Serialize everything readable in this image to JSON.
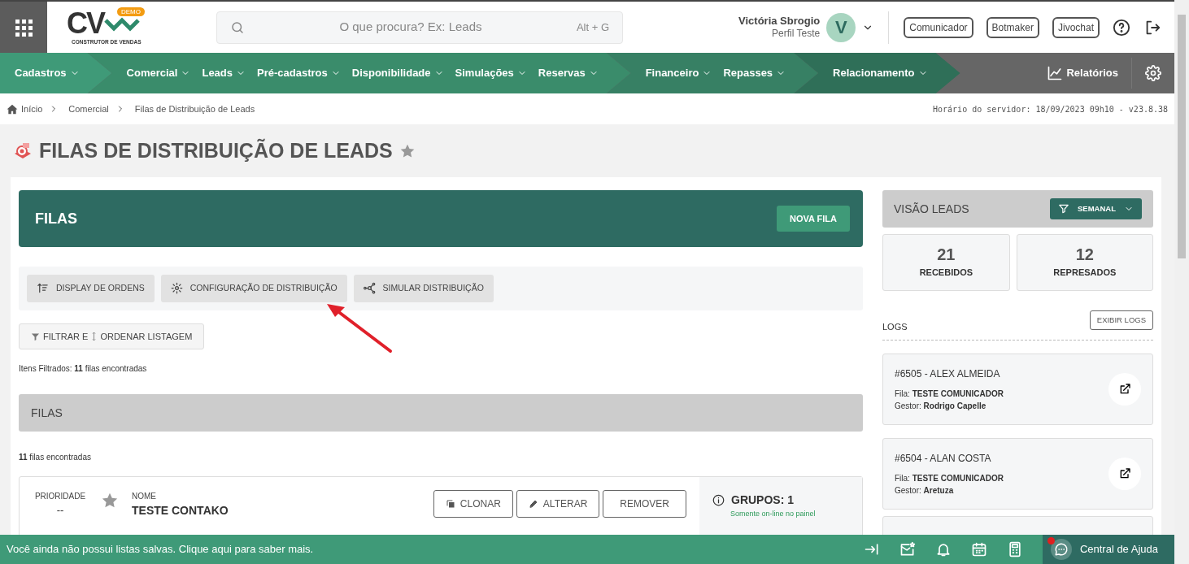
{
  "header": {
    "logo": {
      "mark": "CV",
      "badge": "DEMO",
      "tagline": "CONSTRUTOR DE VENDAS"
    },
    "search": {
      "placeholder": "O que procura? Ex: Leads",
      "shortcut": "Alt + G"
    },
    "user": {
      "name": "Victória Sbrogio",
      "profile": "Perfil Teste",
      "initial": "V"
    },
    "buttons": [
      "Comunicador",
      "Botmaker",
      "Jivochat"
    ]
  },
  "nav": {
    "groups": [
      {
        "color": "#3f9a78",
        "items": [
          "Cadastros"
        ]
      },
      {
        "color": "#3a8c6b",
        "items": [
          "Comercial",
          "Leads",
          "Pré-cadastros",
          "Disponibilidade",
          "Simulações",
          "Reservas"
        ]
      },
      {
        "color": "#378064",
        "items": [
          "Financeiro",
          "Repasses"
        ]
      },
      {
        "color": "#2f6f58",
        "items": [
          "Relacionamento"
        ]
      }
    ],
    "reports": "Relatórios"
  },
  "breadcrumb": {
    "items": [
      "Início",
      "Comercial",
      "Filas de Distribuição de Leads"
    ],
    "server_time": "Horário do servidor: 18/09/2023 09h10 - v23.8.38"
  },
  "page": {
    "title": "FILAS DE DISTRIBUIÇÃO DE LEADS",
    "favorite": false
  },
  "filas": {
    "title": "FILAS",
    "new_button": "NOVA FILA",
    "toolbar": [
      {
        "kind": "sort",
        "label": "DISPLAY DE ORDENS"
      },
      {
        "kind": "gear",
        "label": "CONFIGURAÇÃO DE DISTRIBUIÇÃO"
      },
      {
        "kind": "network",
        "label": "SIMULAR DISTRIBUIÇÃO"
      }
    ],
    "filter_button": {
      "before": "FILTRAR E",
      "after": "ORDENAR LISTAGEM"
    },
    "filtered_text": "Itens Filtrados: **11** filas encontradas",
    "list_title": "FILAS",
    "found_text": "**11** filas encontradas",
    "rows": [
      {
        "priority_label": "PRIORIDADE",
        "priority": "--",
        "favorite": false,
        "name_label": "NOME",
        "name": "TESTE CONTAKO",
        "actions": [
          {
            "kind": "clone",
            "label": "CLONAR"
          },
          {
            "kind": "edit",
            "label": "ALTERAR"
          },
          {
            "kind": "remove",
            "label": "REMOVER"
          }
        ],
        "groups": "GRUPOS: 1",
        "groups_note": "Somente on-line no painel"
      }
    ]
  },
  "leads_view": {
    "title": "VISÃO LEADS",
    "period": "SEMANAL",
    "stats": [
      {
        "value": "21",
        "label": "RECEBIDOS"
      },
      {
        "value": "12",
        "label": "REPRESADOS"
      }
    ],
    "logs_title": "LOGS",
    "logs_button": "EXIBIR LOGS",
    "logs": [
      {
        "title": "#6505 - ALEX ALMEIDA",
        "queue_label": "Fila:",
        "queue": "TESTE COMUNICADOR",
        "manager_label": "Gestor:",
        "manager": "Rodrigo Capelle"
      },
      {
        "title": "#6504 - ALAN COSTA",
        "queue_label": "Fila:",
        "queue": "TESTE COMUNICADOR",
        "manager_label": "Gestor:",
        "manager": "Aretuza"
      }
    ]
  },
  "footer": {
    "message": "Você ainda não possui listas salvas. Clique aqui para saber mais.",
    "help": "Central de Ajuda",
    "help_notification": true
  }
}
